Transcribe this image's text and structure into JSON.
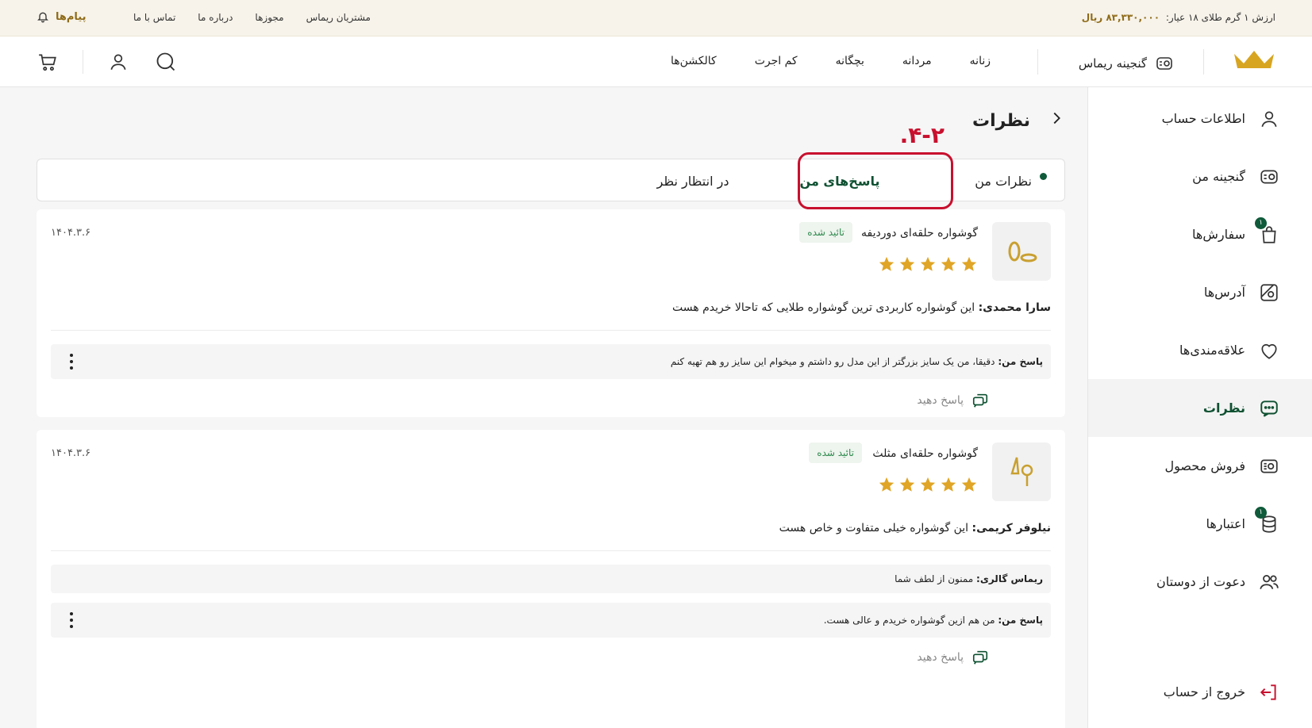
{
  "topbar": {
    "price_label": "ارزش ۱ گرم طلای ۱۸ عیار:",
    "price_value": "۸۳,۳۳۰,۰۰۰ ریال",
    "links": [
      "مشتریان ریماس",
      "مجوزها",
      "درباره ما",
      "تماس با ما"
    ],
    "messages": "پیام‌ها"
  },
  "navbar": {
    "ganjineh": "گنجینه ریماس",
    "menu": [
      "زنانه",
      "مردانه",
      "بچگانه",
      "کم اجرت",
      "کالکشن‌ها"
    ]
  },
  "sidebar": {
    "items": [
      {
        "label": "اطلاعات حساب",
        "icon": "user-icon"
      },
      {
        "label": "گنجینه من",
        "icon": "treasure-icon"
      },
      {
        "label": "سفارش‌ها",
        "icon": "shopping-bag-icon",
        "badge": "۱"
      },
      {
        "label": "آدرس‌ها",
        "icon": "map-icon"
      },
      {
        "label": "علاقه‌مندی‌ها",
        "icon": "heart-icon"
      },
      {
        "label": "نظرات",
        "icon": "comment-icon"
      },
      {
        "label": "فروش محصول",
        "icon": "sell-icon"
      },
      {
        "label": "اعتبارها",
        "icon": "coins-icon",
        "badge": "۱"
      },
      {
        "label": "دعوت از دوستان",
        "icon": "users-icon"
      }
    ],
    "active": "نظرات",
    "logout": "خروج از حساب"
  },
  "page": {
    "title": "نظرات",
    "step_label": ".۴-۲"
  },
  "tabs": [
    "نظرات من",
    "پاسخ‌های من",
    "در انتظار نظر"
  ],
  "accent_color": "#0f5a3a",
  "highlight_color": "#c8102e",
  "reviews": [
    {
      "product": "گوشواره حلقه‌ای دوردیفه",
      "status": "تائید شده",
      "rating": 5,
      "date": "۱۴۰۴.۳.۶",
      "author": "سارا محمدی:",
      "text": "این گوشواره کاربردی ترین گوشواره طلایی که تاحالا خریدم هست",
      "replies": [
        {
          "author": "پاسخ من:",
          "text": "دقیقا، من یک سایز بزرگتر از این مدل رو داشتم و میخوام این سایز رو هم تهیه کنم"
        }
      ],
      "answer_label": "پاسخ دهید"
    },
    {
      "product": "گوشواره حلقه‌ای مثلث",
      "status": "تائید شده",
      "rating": 5,
      "date": "۱۴۰۴.۳.۶",
      "author": "نیلوفر کریمی:",
      "text": "این گوشواره خیلی متفاوت و خاص هست",
      "replies": [
        {
          "author": "ریماس گالری:",
          "text": "ممنون از لطف شما"
        },
        {
          "author": "پاسخ من:",
          "text": "من هم ازین گوشواره خریدم و عالی هست."
        }
      ],
      "answer_label": "پاسخ دهید"
    }
  ]
}
